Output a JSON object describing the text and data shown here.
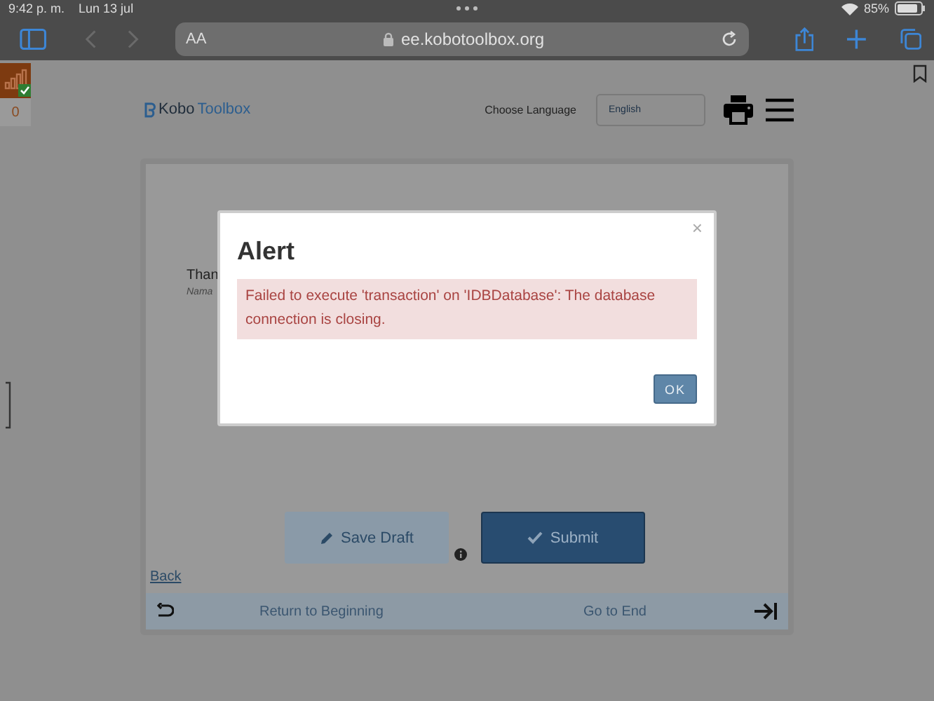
{
  "status_bar": {
    "time": "9:42 p. m.",
    "date": "Lun 13 jul",
    "battery": "85%"
  },
  "browser": {
    "text_size": "AA",
    "url": "ee.kobotoolbox.org"
  },
  "queue_badge": {
    "count": "0"
  },
  "header": {
    "logo": [
      "Kobo",
      "Toolbox"
    ],
    "language_label": "Choose Language",
    "language": "English"
  },
  "form": {
    "question_label": "Than",
    "hint": "Nama",
    "save_button": "Save Draft",
    "submit_button": "Submit",
    "back_link": "Back",
    "footer": {
      "start": "Return to Beginning",
      "end": "Go to End"
    }
  },
  "modal": {
    "title": "Alert",
    "close": "×",
    "message": "Failed to execute 'transaction' on 'IDBDatabase': The database connection is closing.",
    "ok_button": "OK"
  }
}
